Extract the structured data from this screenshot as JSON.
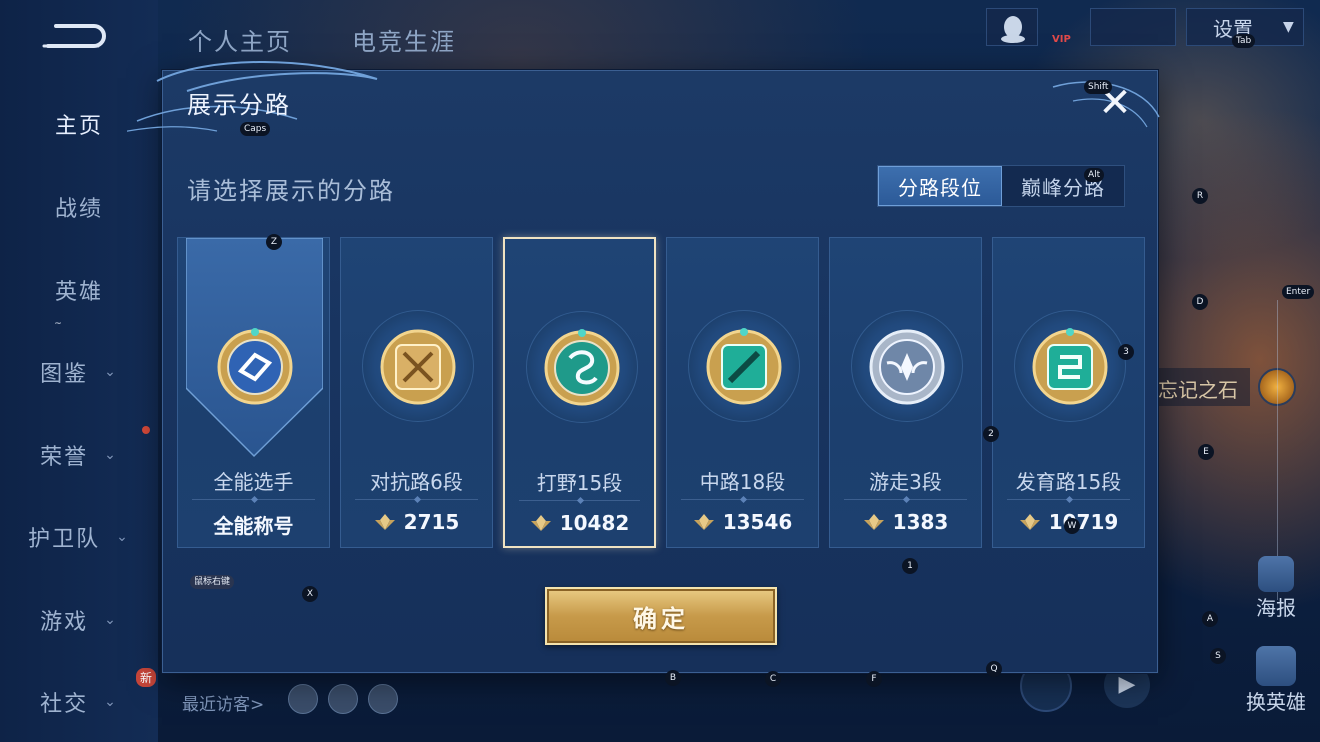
{
  "sidebar": {
    "items": [
      {
        "label": "主页",
        "chevron": false
      },
      {
        "label": "战绩",
        "chevron": false
      },
      {
        "label": "英雄",
        "chevron": false
      },
      {
        "label": "图鉴",
        "chevron": true
      },
      {
        "label": "荣誉",
        "chevron": true
      },
      {
        "label": "护卫队",
        "chevron": true
      },
      {
        "label": "游戏",
        "chevron": true
      },
      {
        "label": "社交",
        "chevron": true
      }
    ],
    "new_badge": "新"
  },
  "topnav": {
    "tab1": "个人主页",
    "tab2": "电竞生涯"
  },
  "topright": {
    "settings": "设置",
    "vip": "VIP"
  },
  "background": {
    "stone_label": "忘记之石",
    "poster": "海报",
    "switch_hero": "换英雄",
    "visitor_label": "最近访客>"
  },
  "modal": {
    "title": "展示分路",
    "subtitle": "请选择展示的分路",
    "tabs": [
      "分路段位",
      "巅峰分路"
    ],
    "cards": [
      {
        "lane": "全能选手",
        "score": "全能称号",
        "has_gem": false,
        "emblem": "all-round-emblem"
      },
      {
        "lane": "对抗路6段",
        "score": "2715",
        "has_gem": true,
        "emblem": "clash-lane-emblem"
      },
      {
        "lane": "打野15段",
        "score": "10482",
        "has_gem": true,
        "emblem": "jungle-emblem"
      },
      {
        "lane": "中路18段",
        "score": "13546",
        "has_gem": true,
        "emblem": "mid-lane-emblem"
      },
      {
        "lane": "游走3段",
        "score": "1383",
        "has_gem": true,
        "emblem": "roam-emblem"
      },
      {
        "lane": "发育路15段",
        "score": "10719",
        "has_gem": true,
        "emblem": "farm-lane-emblem"
      }
    ],
    "confirm": "确定"
  },
  "keycaps": [
    "Tab",
    "Shift",
    "Caps",
    "Alt",
    "R",
    "Z",
    "D",
    "Enter",
    "~",
    "3",
    "2",
    "E",
    "W",
    "1",
    "鼠标右键",
    "X",
    "A",
    "S",
    "B",
    "C",
    "F",
    "Q"
  ],
  "colors": {
    "accent_gold": "#d8b466",
    "selected_border": "#f0e3c2",
    "tab_active": "#3d6fae"
  }
}
